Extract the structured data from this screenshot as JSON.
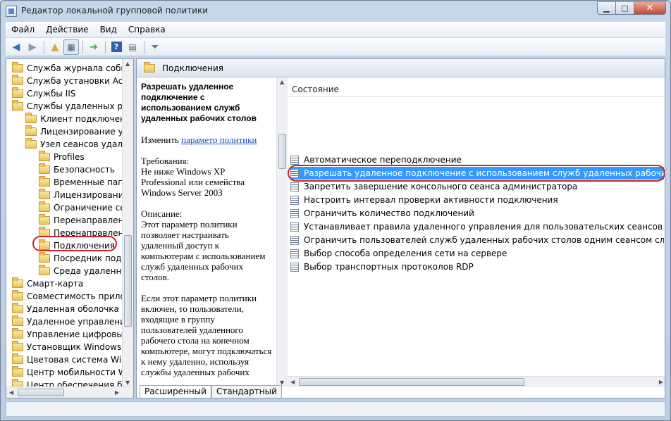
{
  "window": {
    "title": "Редактор локальной групповой политики"
  },
  "menu": [
    "Файл",
    "Действие",
    "Вид",
    "Справка"
  ],
  "toolbar": {
    "icons": [
      "back-arrow-icon",
      "forward-arrow-icon",
      "up-folder-icon",
      "show-hide-tree-icon",
      "export-list-icon",
      "help-icon",
      "properties-icon",
      "filter-icon"
    ]
  },
  "tree": {
    "items": [
      {
        "label": "Служба журнала событий",
        "level": 0
      },
      {
        "label": "Служба установки ActiveX",
        "level": 0
      },
      {
        "label": "Службы IIS",
        "level": 0
      },
      {
        "label": "Службы удаленных рабочих столов",
        "level": 0
      },
      {
        "label": "Клиент подключения к удаленному рабочему столу",
        "level": 1
      },
      {
        "label": "Лицензирование удаленных рабочих столов",
        "level": 1
      },
      {
        "label": "Узел сеансов удаленных рабочих столов",
        "level": 1
      },
      {
        "label": "Profiles",
        "level": 2
      },
      {
        "label": "Безопасность",
        "level": 2
      },
      {
        "label": "Временные папки",
        "level": 2
      },
      {
        "label": "Лицензирование",
        "level": 2
      },
      {
        "label": "Ограничение сеансов по времени",
        "level": 2
      },
      {
        "label": "Перенаправление принтеров",
        "level": 2
      },
      {
        "label": "Перенаправление устройств и ресурсов",
        "level": 2
      },
      {
        "label": "Подключения",
        "level": 2,
        "selected": true
      },
      {
        "label": "Посредник подключений",
        "level": 2
      },
      {
        "label": "Среда удаленных сеансов",
        "level": 2
      },
      {
        "label": "Смарт-карта",
        "level": 0
      },
      {
        "label": "Совместимость приложений",
        "level": 0
      },
      {
        "label": "Удаленная оболочка Windows",
        "level": 0
      },
      {
        "label": "Удаленное управление Windows",
        "level": 0
      },
      {
        "label": "Управление цифровыми правами",
        "level": 0
      },
      {
        "label": "Установщик Windows",
        "level": 0
      },
      {
        "label": "Цветовая система Windows",
        "level": 0
      },
      {
        "label": "Центр мобильности Windows",
        "level": 0
      },
      {
        "label": "Центр обеспечения безопасности",
        "level": 0
      }
    ]
  },
  "pane": {
    "title": "Подключения",
    "description": {
      "setting_title": "Разрешать удаленное подключение с использованием служб удаленных рабочих столов",
      "edit_prefix": "Изменить",
      "edit_link": "параметр политики",
      "requirements_label": "Требования:",
      "requirements_text": "Не ниже Windows XP Professional или семейства Windows Server 2003",
      "description_label": "Описание:",
      "description_text": "Этот параметр политики позволяет настраивать удаленный доступ к компьютерам с использованием служб удаленных рабочих столов.",
      "description_text2": "Если этот параметр политики включен, то пользователи, входящие в группу пользователей удаленного рабочего стола на конечном компьютере, могут подключаться к нему удаленно, используя службы удаленных рабочих столов."
    },
    "column_header": "Состояние",
    "settings": [
      "Автоматическое переподключение",
      "Разрешать удаленное подключение с использованием служб удаленных рабочих столов",
      "Запретить завершение консольного сеанса администратора",
      "Настроить интервал проверки активности подключения",
      "Ограничить количество подключений",
      "Устанавливает правила удаленного управления для пользовательских сеансов служб удаленных рабочих столов",
      "Ограничить пользователей служб удаленных рабочих столов одним сеансом служб удаленных рабочих столов",
      "Выбор способа определения сети на сервере",
      "Выбор транспортных протоколов RDP"
    ],
    "selected_index": 1,
    "tabs": [
      "Расширенный",
      "Стандартный"
    ]
  }
}
